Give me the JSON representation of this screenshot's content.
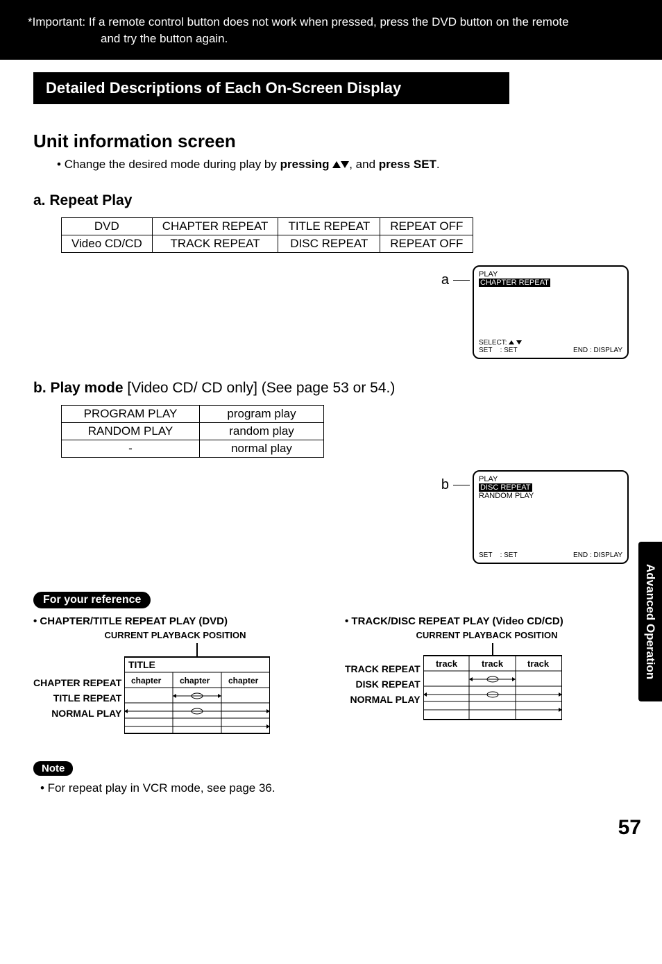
{
  "topNote": {
    "prefix": "*Important:",
    "line1": "If a remote control button does not work when pressed, press the DVD button on the remote",
    "line2": "and try the button again."
  },
  "sectionBar": "Detailed Descriptions of Each On-Screen Display",
  "unitInfoTitle": "Unit information screen",
  "unitInfoBullet": {
    "pre": "Change the desired mode during play by ",
    "pressing": "pressing",
    "post": ", and ",
    "pressSet": "press SET",
    "end": "."
  },
  "repeat": {
    "heading": "a. Repeat Play",
    "rows": [
      [
        "DVD",
        "CHAPTER REPEAT",
        "TITLE REPEAT",
        "REPEAT OFF"
      ],
      [
        "Video CD/CD",
        "TRACK REPEAT",
        "DISC REPEAT",
        "REPEAT OFF"
      ]
    ]
  },
  "osdA": {
    "label": "a",
    "play": "PLAY",
    "hl": "CHAPTER REPEAT",
    "select": "SELECT:",
    "set": "SET",
    "setVal": ": SET",
    "end": "END",
    "endVal": ": DISPLAY"
  },
  "playmode": {
    "heading": "b. Play mode",
    "suffix": " [Video CD/ CD only] (See page 53 or 54.)",
    "rows": [
      [
        "PROGRAM PLAY",
        "program play"
      ],
      [
        "RANDOM PLAY",
        "random play"
      ],
      [
        "-",
        "normal play"
      ]
    ]
  },
  "osdB": {
    "label": "b",
    "play": "PLAY",
    "hl": "DISC REPEAT",
    "line2": "RANDOM PLAY",
    "set": "SET",
    "setVal": ": SET",
    "end": "END",
    "endVal": ": DISPLAY"
  },
  "refPill": "For your reference",
  "refLeft": {
    "title": "• CHAPTER/TITLE REPEAT PLAY (DVD)",
    "sub": "CURRENT PLAYBACK POSITION",
    "tableTitle": "TITLE",
    "cols": [
      "chapter",
      "chapter",
      "chapter"
    ],
    "rows": [
      "CHAPTER REPEAT",
      "TITLE REPEAT",
      "NORMAL PLAY"
    ]
  },
  "refRight": {
    "title": "• TRACK/DISC REPEAT PLAY (Video CD/CD)",
    "sub": "CURRENT PLAYBACK POSITION",
    "cols": [
      "track",
      "track",
      "track"
    ],
    "rows": [
      "TRACK REPEAT",
      "DISK REPEAT",
      "NORMAL PLAY"
    ]
  },
  "sideTab": "Advanced Operation",
  "notePill": "Note",
  "noteText": "• For repeat play in VCR mode, see page 36.",
  "pageNum": "57"
}
